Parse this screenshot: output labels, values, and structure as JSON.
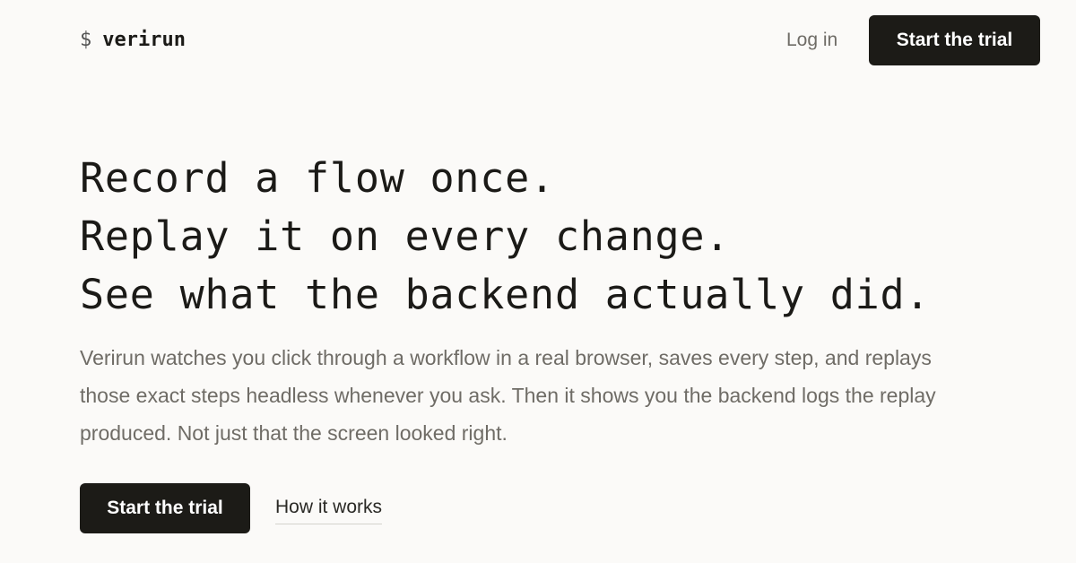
{
  "header": {
    "logo_prompt": "$",
    "logo_name": "verirun",
    "login_label": "Log in",
    "cta_label": "Start the trial"
  },
  "hero": {
    "headline_lines": [
      "Record a flow once.",
      "Replay it on every change.",
      "See what the backend actually did."
    ],
    "description": "Verirun watches you click through a workflow in a real browser, saves every step, and replays those exact steps headless whenever you ask. Then it shows you the backend logs the replay produced. Not just that the screen looked right.",
    "primary_cta": "Start the trial",
    "secondary_cta": "How it works"
  },
  "colors": {
    "background": "#fbfaf8",
    "button_dark": "#1c1b17",
    "muted_text": "#6f6c66"
  }
}
